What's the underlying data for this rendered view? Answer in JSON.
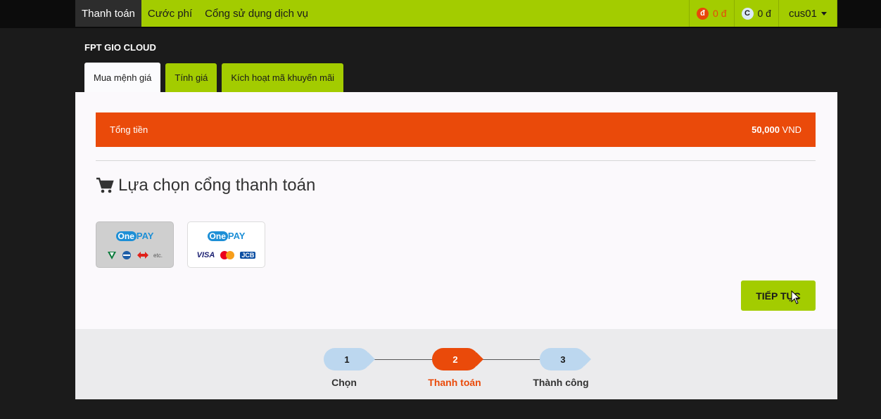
{
  "nav": {
    "items": [
      {
        "label": "Thanh toán",
        "active": true
      },
      {
        "label": "Cước phí",
        "active": false
      },
      {
        "label": "Cổng sử dụng dịch vụ",
        "active": false
      }
    ],
    "balance_dong": {
      "icon": "đ",
      "amount": "0 đ"
    },
    "balance_credit": {
      "icon": "C",
      "amount": "0 đ"
    },
    "user": "cus01"
  },
  "service_title": "FPT GIO CLOUD",
  "tabs": [
    {
      "label": "Mua mệnh giá",
      "active": true
    },
    {
      "label": "Tính giá",
      "active": false
    },
    {
      "label": "Kích hoạt mã khuyến mãi",
      "active": false
    }
  ],
  "total": {
    "label": "Tổng tiền",
    "amount": "50,000",
    "currency": "VND"
  },
  "gateway_heading": "Lựa chọn cổng thanh toán",
  "gateways": [
    {
      "name": "OnePay Domestic",
      "logo_one": "One",
      "logo_pay": "PAY",
      "extra": "etc.",
      "icons": [
        "vietcombank-icon",
        "bidv-icon",
        "techcombank-icon"
      ]
    },
    {
      "name": "OnePay International",
      "logo_one": "One",
      "logo_pay": "PAY",
      "cards": [
        "VISA",
        "mastercard",
        "JCB"
      ]
    }
  ],
  "continue_label": "TIẾP TỤC",
  "steps": [
    {
      "number": "1",
      "label": "Chọn",
      "state": "done"
    },
    {
      "number": "2",
      "label": "Thanh toán",
      "state": "current"
    },
    {
      "number": "3",
      "label": "Thành công",
      "state": "todo"
    }
  ],
  "colors": {
    "accent_green": "#a3cc00",
    "accent_orange": "#ea4a0a",
    "step_blue": "#bcd7ef"
  }
}
